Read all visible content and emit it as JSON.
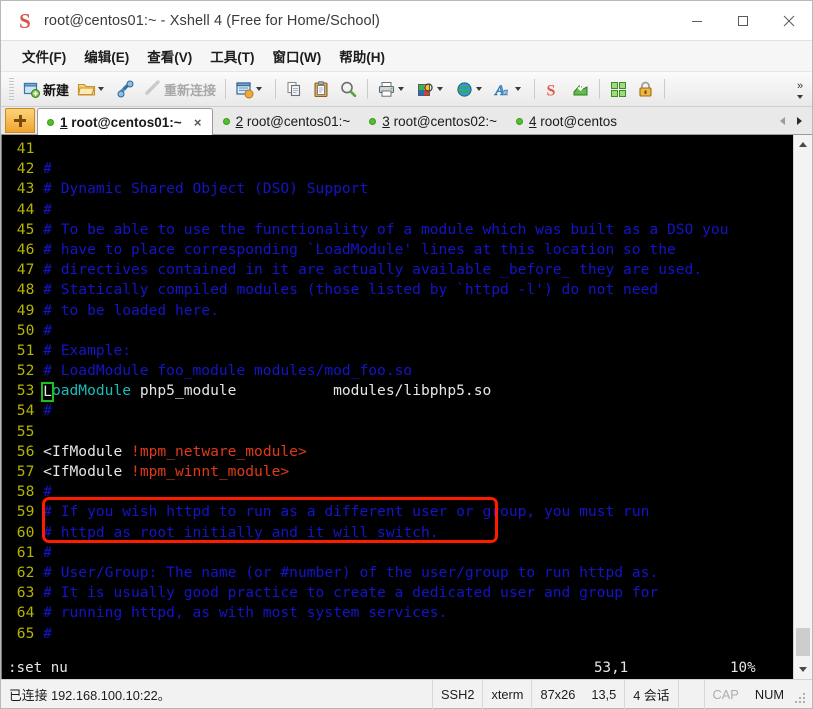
{
  "window": {
    "title": "root@centos01:~ - Xshell 4 (Free for Home/School)",
    "icon": "xshell-logo-icon",
    "minimize": "─",
    "maximize": "□",
    "close": "✕"
  },
  "menubar": {
    "items": [
      {
        "label": "文件(F)",
        "name": "menu-file"
      },
      {
        "label": "编辑(E)",
        "name": "menu-edit"
      },
      {
        "label": "查看(V)",
        "name": "menu-view"
      },
      {
        "label": "工具(T)",
        "name": "menu-tools"
      },
      {
        "label": "窗口(W)",
        "name": "menu-window"
      },
      {
        "label": "帮助(H)",
        "name": "menu-help"
      }
    ]
  },
  "toolbar": {
    "new_label": "新建",
    "reconnect_label": "重新连接",
    "overflow_label": "»",
    "icons": [
      "new-session-icon",
      "open-folder-icon",
      "connect-icon",
      "disconnect-icon",
      "session-manager-icon",
      "copy-icon",
      "paste-icon",
      "find-icon",
      "print-icon",
      "color-scheme-icon",
      "globe-icon",
      "font-icon",
      "xshell-icon",
      "xftp-icon",
      "arrange-icon",
      "lock-icon"
    ]
  },
  "tabs": {
    "new_tab_name": "new-tab-button",
    "items": [
      {
        "num": "1",
        "label": "root@centos01:~",
        "active": true,
        "close": "×"
      },
      {
        "num": "2",
        "label": "root@centos01:~",
        "active": false,
        "close": ""
      },
      {
        "num": "3",
        "label": "root@centos02:~",
        "active": false,
        "close": ""
      },
      {
        "num": "4",
        "label": "root@centos",
        "active": false,
        "close": ""
      }
    ]
  },
  "terminal": {
    "lines": [
      {
        "n": "41",
        "segs": []
      },
      {
        "n": "42",
        "segs": [
          {
            "t": "#",
            "c": "cmt"
          }
        ]
      },
      {
        "n": "43",
        "segs": [
          {
            "t": "# Dynamic Shared Object (DSO) Support",
            "c": "cmt"
          }
        ]
      },
      {
        "n": "44",
        "segs": [
          {
            "t": "#",
            "c": "cmt"
          }
        ]
      },
      {
        "n": "45",
        "segs": [
          {
            "t": "# To be able to use the functionality of a module which was built as a DSO you",
            "c": "cmt"
          }
        ]
      },
      {
        "n": "46",
        "segs": [
          {
            "t": "# have to place corresponding `LoadModule' lines at this location so the",
            "c": "cmt"
          }
        ]
      },
      {
        "n": "47",
        "segs": [
          {
            "t": "# directives contained in it are actually available _before_ they are used.",
            "c": "cmt"
          }
        ]
      },
      {
        "n": "48",
        "segs": [
          {
            "t": "# Statically compiled modules (those listed by `httpd -l') do not need",
            "c": "cmt"
          }
        ]
      },
      {
        "n": "49",
        "segs": [
          {
            "t": "# to be loaded here.",
            "c": "cmt"
          }
        ]
      },
      {
        "n": "50",
        "segs": [
          {
            "t": "#",
            "c": "cmt"
          }
        ]
      },
      {
        "n": "51",
        "segs": [
          {
            "t": "# Example:",
            "c": "cmt"
          }
        ]
      },
      {
        "n": "52",
        "segs": [
          {
            "t": "# LoadModule foo_module modules/mod_foo.so",
            "c": "cmt"
          }
        ]
      },
      {
        "n": "53",
        "segs": [
          {
            "t": "L",
            "c": "cursor"
          },
          {
            "t": "oadModule",
            "c": "cyan"
          },
          {
            "t": " php5_module           modules/libphp5.so",
            "c": "white"
          }
        ]
      },
      {
        "n": "54",
        "segs": [
          {
            "t": "#",
            "c": "cmt"
          }
        ]
      },
      {
        "n": "55",
        "segs": []
      },
      {
        "n": "56",
        "segs": [
          {
            "t": "<IfModule ",
            "c": "white"
          },
          {
            "t": "!mpm_netware_module>",
            "c": "red"
          }
        ]
      },
      {
        "n": "57",
        "segs": [
          {
            "t": "<IfModule ",
            "c": "white"
          },
          {
            "t": "!mpm_winnt_module>",
            "c": "red"
          }
        ]
      },
      {
        "n": "58",
        "segs": [
          {
            "t": "#",
            "c": "cmt"
          }
        ]
      },
      {
        "n": "59",
        "segs": [
          {
            "t": "# If you wish httpd to run as a different user or group, you must run",
            "c": "cmt"
          }
        ]
      },
      {
        "n": "60",
        "segs": [
          {
            "t": "# httpd as root initially and it will switch.",
            "c": "cmt"
          }
        ]
      },
      {
        "n": "61",
        "segs": [
          {
            "t": "#",
            "c": "cmt"
          }
        ]
      },
      {
        "n": "62",
        "segs": [
          {
            "t": "# User/Group: The name (or #number) of the user/group to run httpd as.",
            "c": "cmt"
          }
        ]
      },
      {
        "n": "63",
        "segs": [
          {
            "t": "# It is usually good practice to create a dedicated user and group for",
            "c": "cmt"
          }
        ]
      },
      {
        "n": "64",
        "segs": [
          {
            "t": "# running httpd, as with most system services.",
            "c": "cmt"
          }
        ]
      },
      {
        "n": "65",
        "segs": [
          {
            "t": "#",
            "c": "cmt"
          }
        ]
      }
    ],
    "vim_status": {
      "command": ":set nu",
      "position": "53,1",
      "percent": "10%"
    },
    "highlight_color": "#ff1a00",
    "cursor_color": "#1cc21c"
  },
  "statusbar": {
    "connection": "已连接 192.168.100.10:22。",
    "protocol": "SSH2",
    "term_type": "xterm",
    "size": "87x26",
    "cursor": "13,5",
    "sessions": "4 会话",
    "caps": "CAP",
    "num": "NUM"
  }
}
